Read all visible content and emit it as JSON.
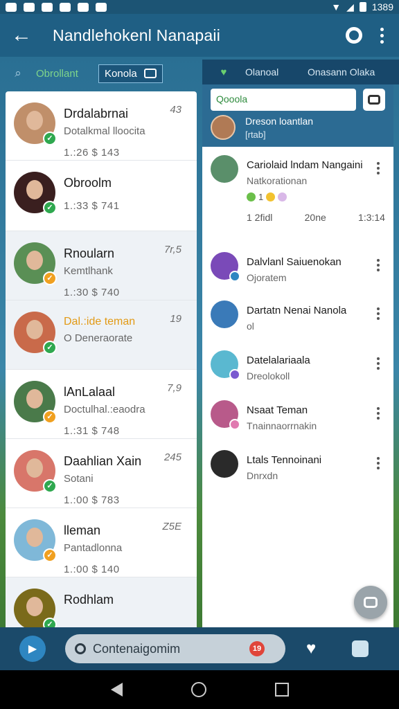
{
  "status_bar": {
    "time": "1389"
  },
  "app_bar": {
    "title": "Nandlehokenl Nanapaii"
  },
  "left_tabs": {
    "online": "Obrollant",
    "box": "Konola"
  },
  "contacts": [
    {
      "name": "Drdalabrnai",
      "sub": "Dotalkmal lloocita",
      "meta": "1.:26 $ 143",
      "count": "43",
      "avatar_color": "#c08f6a",
      "badge_color": "#2fa84f",
      "highlight": false,
      "emoji": ""
    },
    {
      "name": "Obroolm",
      "sub": "",
      "meta": "1.:33 $ 741",
      "count": "",
      "avatar_color": "#3a1f1f",
      "badge_color": "#2fa84f",
      "highlight": false,
      "emoji": "😊"
    },
    {
      "name": "Rnoularn",
      "sub": "Kemtlhank",
      "meta": "1.:30 $ 740",
      "count": "7r,5",
      "avatar_color": "#5a8f55",
      "badge_color": "#f0a020",
      "highlight": false,
      "emoji": "😊"
    },
    {
      "name": "Dal.:ide teman",
      "sub": "O Deneraorate",
      "meta": "",
      "count": "19",
      "avatar_color": "#c96a4a",
      "badge_color": "#2fa84f",
      "highlight": true,
      "emoji": ""
    },
    {
      "name": "lAnLalaal",
      "sub": "Doctulhal.:eaodra",
      "meta": "1.:31 $ 748",
      "count": "7,9",
      "avatar_color": "#4a7a4a",
      "badge_color": "#f0a020",
      "highlight": false,
      "emoji": ""
    },
    {
      "name": "Daahlian Xain",
      "sub": "Sotani",
      "meta": "1.:00 $ 783",
      "count": "245",
      "avatar_color": "#d8766a",
      "badge_color": "#2fa84f",
      "highlight": false,
      "emoji": ""
    },
    {
      "name": "lleman",
      "sub": "Pantadlonna",
      "meta": "1.:00 $ 140",
      "count": "Z5E",
      "avatar_color": "#7fb8d8",
      "badge_color": "#f0a020",
      "highlight": false,
      "emoji": "😊"
    },
    {
      "name": "Rodhlam",
      "sub": "",
      "meta": "",
      "count": "",
      "avatar_color": "#7a6a1a",
      "badge_color": "#2fa84f",
      "highlight": false,
      "emoji": "😊"
    }
  ],
  "right_tabs": {
    "tab1": "Olanoal",
    "tab2": "Onasann Olaka"
  },
  "right_header": {
    "search_text": "Qooola",
    "pinned_name": "Dreson loantlan",
    "pinned_sub": "[rtab]"
  },
  "right_contacts": [
    {
      "name": "Cariolaid lndam Nangaini",
      "sub": "Natkorationan",
      "avatar_color": "#5a8f6a",
      "badge_color": "",
      "extra": "1",
      "stats": [
        "1 2fidl",
        "20ne",
        "1:3:14"
      ]
    },
    {
      "name": "Dalvlanl Saiuenokan",
      "sub": "Ojoratem",
      "avatar_color": "#7a4ab8",
      "badge_color": "#2e86c1",
      "extra": "",
      "stats": []
    },
    {
      "name": "Dartatn Nenai Nanola",
      "sub": "ol",
      "avatar_color": "#3a7ab8",
      "badge_color": "",
      "extra": "",
      "stats": []
    },
    {
      "name": "Datelalariaala",
      "sub": "Dreolokoll",
      "avatar_color": "#5ab8d0",
      "badge_color": "#7a5ad0",
      "extra": "",
      "stats": []
    },
    {
      "name": "Nsaat Teman",
      "sub": "Tnainnaorrnakin",
      "avatar_color": "#b85a8a",
      "badge_color": "#e07ab0",
      "extra": "",
      "stats": []
    },
    {
      "name": "Ltals Tennoinani",
      "sub": "Dnrxdn",
      "avatar_color": "#2a2a2a",
      "badge_color": "",
      "extra": "",
      "stats": []
    }
  ],
  "bottom_bar": {
    "search_placeholder": "Contenaigomim",
    "notification_count": "19"
  }
}
